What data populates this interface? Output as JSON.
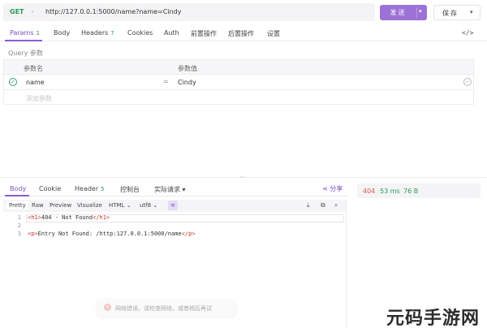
{
  "request": {
    "method": "GET",
    "url": "http://127.0.0.1:5000/name?name=Cindy",
    "send_label": "发送",
    "save_label": "保存"
  },
  "req_tabs": [
    {
      "label": "Params",
      "count": "1"
    },
    {
      "label": "Body",
      "count": ""
    },
    {
      "label": "Headers",
      "count": "7"
    },
    {
      "label": "Cookies",
      "count": ""
    },
    {
      "label": "Auth",
      "count": ""
    },
    {
      "label": "前置操作",
      "count": ""
    },
    {
      "label": "后置操作",
      "count": ""
    },
    {
      "label": "设置",
      "count": ""
    }
  ],
  "query": {
    "title": "Query 参数",
    "col_name": "参数名",
    "col_value": "参数值",
    "param_name": "name",
    "param_value": "Cindy",
    "add_placeholder": "添加参数"
  },
  "resp_tabs": [
    {
      "label": "Body",
      "count": ""
    },
    {
      "label": "Cookie",
      "count": ""
    },
    {
      "label": "Header",
      "count": "5"
    },
    {
      "label": "控制台",
      "count": ""
    },
    {
      "label": "实际请求",
      "count": ""
    }
  ],
  "share_label": "分享",
  "resp_toolbar": {
    "pretty": "Pretty",
    "raw": "Raw",
    "preview": "Preview",
    "visualize": "Visualize",
    "format": "HTML",
    "encoding": "utf8"
  },
  "code_lines": [
    {
      "num": "1",
      "pre": "",
      "open": "<h1>",
      "text": "404 - Not Found",
      "close": "</h1>"
    },
    {
      "num": "2",
      "pre": "",
      "open": "",
      "text": "",
      "close": ""
    },
    {
      "num": "3",
      "pre": "",
      "open": "<p>",
      "text": "Entry Not Found: /http:127.0.0.1:5000/name",
      "close": "</p>"
    }
  ],
  "toast_text": "网络错误，请检查网络，或者稍后再试",
  "status": {
    "code": "404",
    "time": "53 ms",
    "size": "76 B"
  },
  "watermark": "元码手游网",
  "colors": {
    "accent": "#8a5ed0",
    "success": "#2b9a55",
    "error": "#d65c4a"
  }
}
